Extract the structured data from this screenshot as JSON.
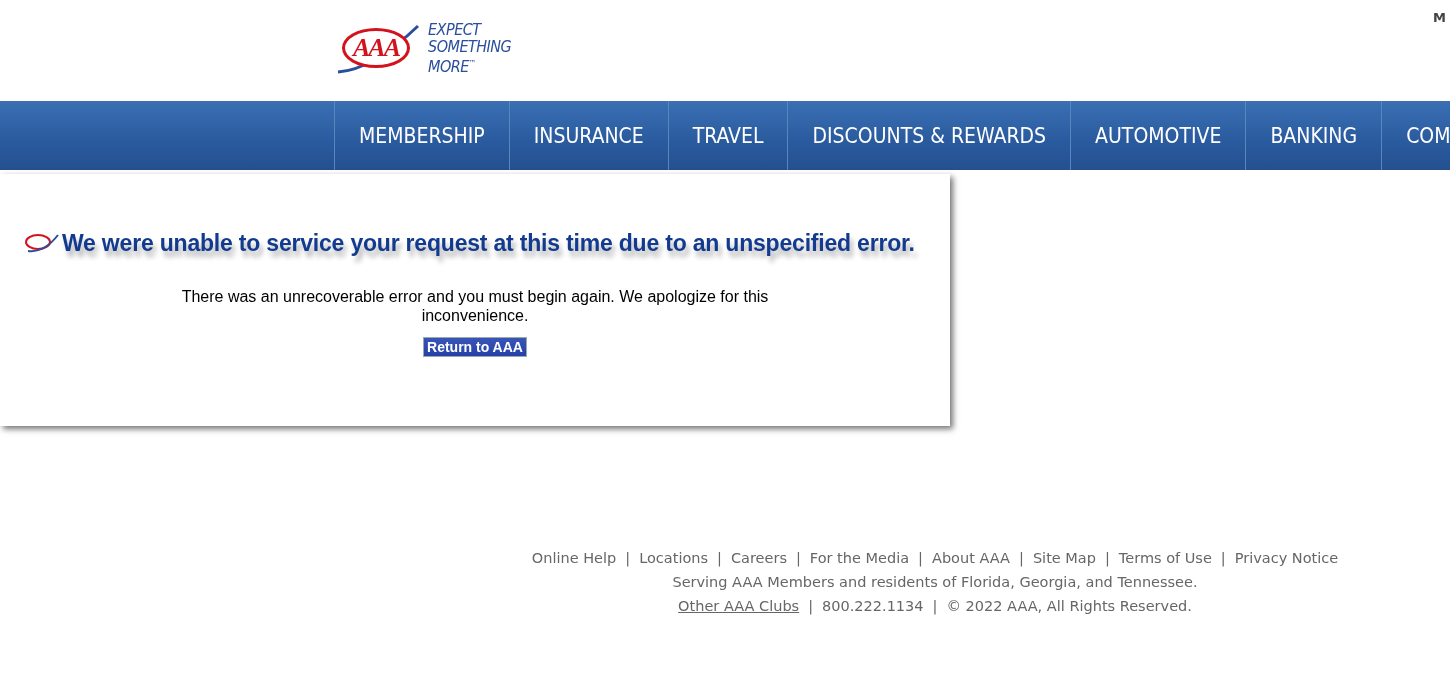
{
  "header": {
    "logo_letters": "AAA",
    "tagline": [
      "EXPECT",
      "SOMETHING",
      "MORE"
    ],
    "trademark": "™",
    "top_link": "M"
  },
  "nav": [
    "MEMBERSHIP",
    "INSURANCE",
    "TRAVEL",
    "DISCOUNTS & REWARDS",
    "AUTOMOTIVE",
    "BANKING",
    "COM"
  ],
  "error": {
    "title": "We were unable to service your request at this time due to an unspecified error.",
    "message": "There was an unrecoverable error and you must begin again. We apologize for this inconvenience.",
    "button": "Return to AAA"
  },
  "footer": {
    "links": [
      "Online Help",
      "Locations",
      "Careers",
      "For the Media",
      "About AAA",
      "Site Map",
      "Terms of Use",
      "Privacy Notice"
    ],
    "separator": "|",
    "serving": "Serving AAA Members and residents of Florida, Georgia, and Tennessee.",
    "bottom": [
      {
        "kind": "link",
        "text": "Other AAA Clubs"
      },
      {
        "kind": "text",
        "text": "800.222.1134"
      },
      {
        "kind": "text",
        "text": "© 2022 AAA, All Rights Reserved."
      }
    ]
  }
}
